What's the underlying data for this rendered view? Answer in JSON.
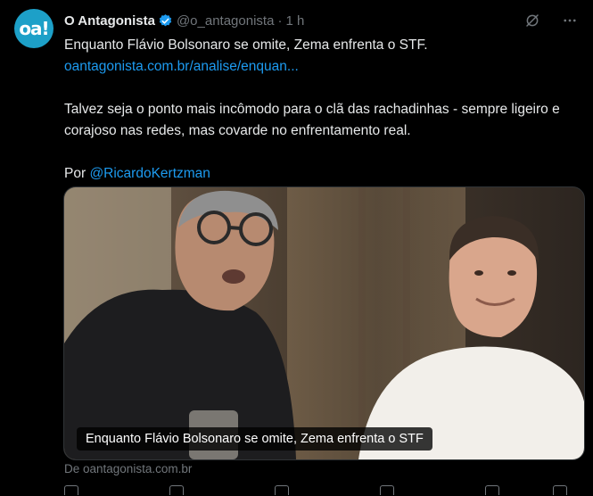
{
  "account": {
    "avatar_text": "oa!",
    "name": "O Antagonista",
    "handle": "@o_antagonista",
    "separator": "·",
    "time": "1 h"
  },
  "header_icons": [
    "grok-icon",
    "more-icon"
  ],
  "tweet": {
    "title": "Enquanto Flávio Bolsonaro se omite, Zema enfrenta o STF.",
    "link": "oantagonista.com.br/analise/enquan...",
    "paragraph": "Talvez seja o ponto mais incômodo para o clã das rachadinhas - sempre ligeiro e corajoso nas redes, mas covarde no enfrentamento real.",
    "byline_prefix": "Por",
    "byline_mention": "@RicardoKertzman"
  },
  "card": {
    "caption": "Enquanto Flávio Bolsonaro se omite, Zema enfrenta o STF",
    "source": "De oantagonista.com.br"
  },
  "colors": {
    "background": "#000000",
    "text": "#e7e9ea",
    "secondary": "#71767b",
    "link": "#1d9bf0",
    "avatar": "#1da0c8"
  }
}
